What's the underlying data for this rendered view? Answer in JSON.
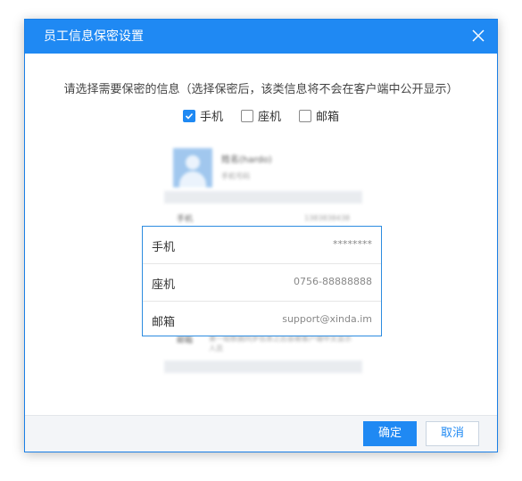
{
  "dialog": {
    "title": "员工信息保密设置",
    "description": "请选择需要保密的信息（选择保密后，该类信息将不会在客户端中公开显示）",
    "options": [
      {
        "label": "手机",
        "checked": true
      },
      {
        "label": "座机",
        "checked": false
      },
      {
        "label": "邮箱",
        "checked": false
      }
    ],
    "preview": {
      "name": "姓名(hardo)",
      "subtitle": "手机号码",
      "phone_label": "手机",
      "phone_value": "1383838438",
      "note_label": "邮箱",
      "note_value": "第一组数据同步信息之后会被客户端中文显示人员"
    },
    "card": {
      "rows": [
        {
          "label": "手机",
          "value": "********"
        },
        {
          "label": "座机",
          "value": "0756-88888888"
        },
        {
          "label": "邮箱",
          "value": "support@xinda.im"
        }
      ]
    },
    "buttons": {
      "confirm": "确定",
      "cancel": "取消"
    }
  },
  "colors": {
    "accent": "#1f89f3",
    "card_border": "#2d8ce0"
  }
}
